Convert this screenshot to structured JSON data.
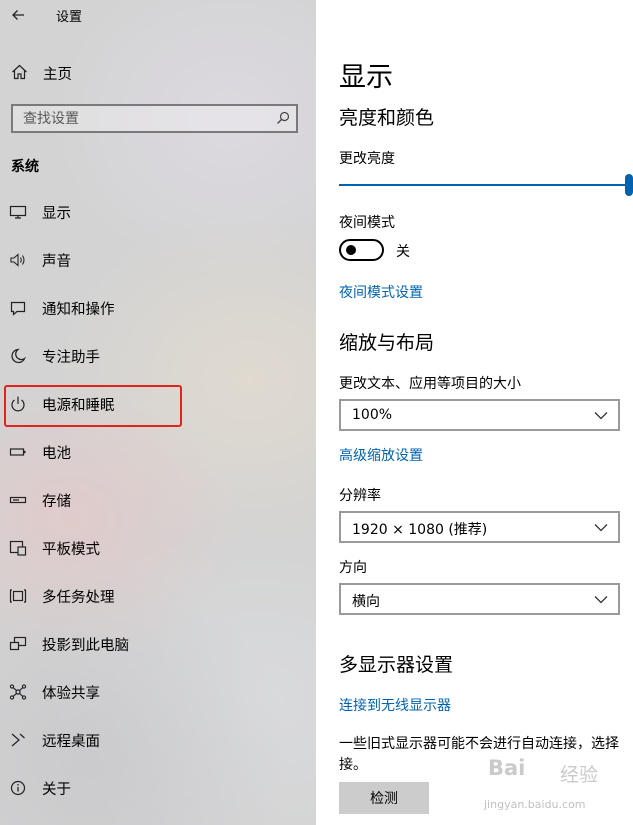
{
  "window": {
    "title": "设置"
  },
  "sidebar": {
    "home_label": "主页",
    "search_placeholder": "查找设置",
    "section_title": "系统",
    "selected_item": "电源和睡眠",
    "items": [
      {
        "label": "显示",
        "icon": "monitor-icon"
      },
      {
        "label": "声音",
        "icon": "speaker-icon"
      },
      {
        "label": "通知和操作",
        "icon": "notification-icon"
      },
      {
        "label": "专注助手",
        "icon": "moon-icon"
      },
      {
        "label": "电源和睡眠",
        "icon": "power-icon"
      },
      {
        "label": "电池",
        "icon": "battery-icon"
      },
      {
        "label": "存储",
        "icon": "storage-icon"
      },
      {
        "label": "平板模式",
        "icon": "tablet-mode-icon"
      },
      {
        "label": "多任务处理",
        "icon": "multitasking-icon"
      },
      {
        "label": "投影到此电脑",
        "icon": "project-icon"
      },
      {
        "label": "体验共享",
        "icon": "shared-experiences-icon"
      },
      {
        "label": "远程桌面",
        "icon": "remote-desktop-icon"
      },
      {
        "label": "关于",
        "icon": "info-icon"
      }
    ]
  },
  "content": {
    "page_title": "显示",
    "brightness": {
      "heading": "亮度和颜色",
      "slider_label": "更改亮度",
      "value": 1.0
    },
    "night_light": {
      "label": "夜间模式",
      "state_text": "关",
      "settings_link": "夜间模式设置"
    },
    "scale_layout": {
      "heading": "缩放与布局",
      "scale_label": "更改文本、应用等项目的大小",
      "scale_value": "100%",
      "advanced_link": "高级缩放设置",
      "resolution_label": "分辨率",
      "resolution_value": "1920 × 1080 (推荐)",
      "orientation_label": "方向",
      "orientation_value": "横向"
    },
    "multi_display": {
      "heading": "多显示器设置",
      "wireless_link": "连接到无线显示器",
      "description_line1": "一些旧式显示器可能不会进行自动连接，选择",
      "description_line2": "接。",
      "detect_button": "检测"
    }
  },
  "watermark": {
    "logo": "Bai",
    "text": "经验",
    "url": "jingyan.baidu.com"
  },
  "colors": {
    "accent": "#0063b1",
    "highlight_box": "#e2231a"
  }
}
